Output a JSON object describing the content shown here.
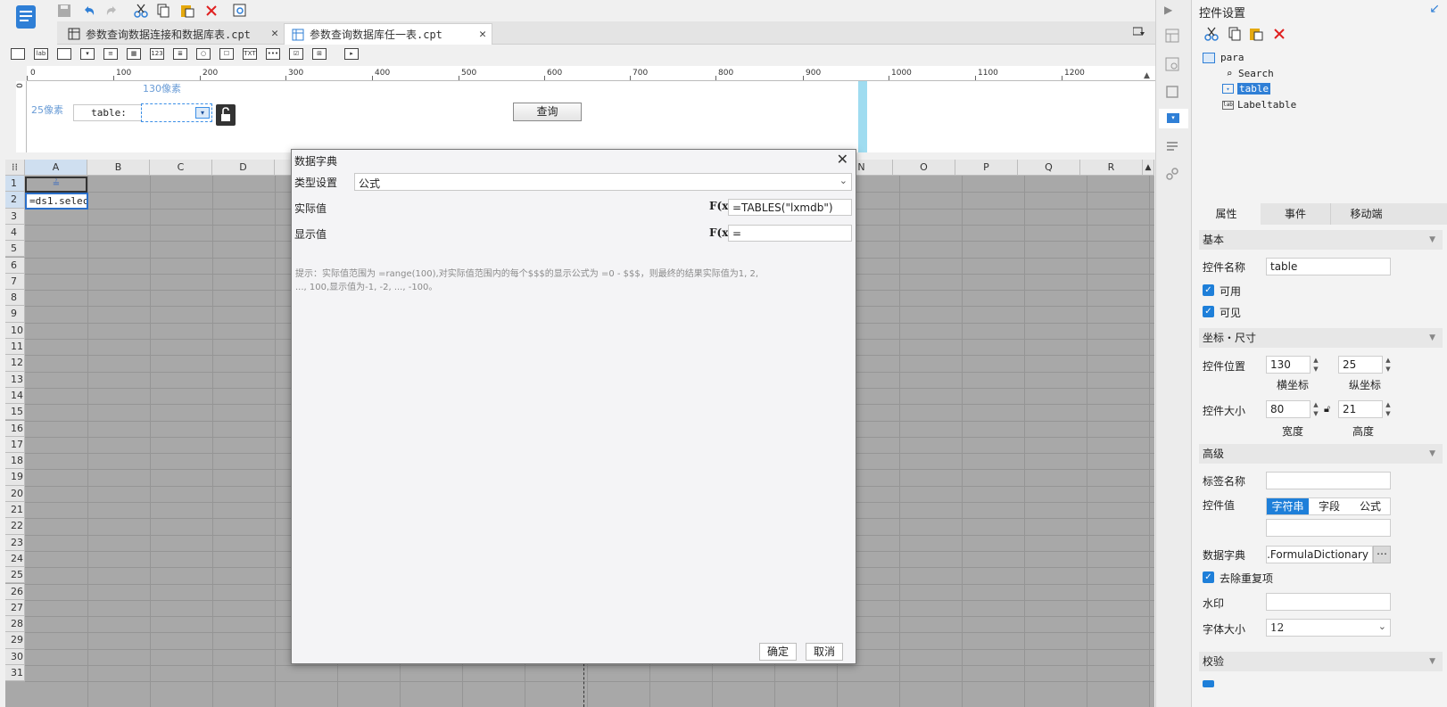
{
  "tabs": [
    {
      "label": "参数查询数据连接和数据库表.cpt"
    },
    {
      "label": "参数查询数据库任一表.cpt"
    }
  ],
  "ruler": {
    "ticks": [
      "0",
      "100",
      "200",
      "300",
      "400",
      "500",
      "600",
      "700",
      "800",
      "900",
      "1000",
      "1100",
      "1200"
    ],
    "vzero": "0"
  },
  "param": {
    "hint_x": "130像素",
    "hint_y": "25像素",
    "label": "table:",
    "query_button": "查询"
  },
  "sheet": {
    "columns": [
      "A",
      "B",
      "C",
      "D",
      "N",
      "O",
      "P",
      "Q",
      "R"
    ],
    "rows": [
      "1",
      "2",
      "3",
      "4",
      "5",
      "6",
      "7",
      "8",
      "9",
      "10",
      "11",
      "12",
      "13",
      "14",
      "15",
      "16",
      "17",
      "18",
      "19",
      "20",
      "21",
      "22",
      "23",
      "24",
      "25",
      "26",
      "27",
      "28",
      "29",
      "30",
      "31"
    ],
    "cell_a1": "≟",
    "cell_a2": "=ds1.selec"
  },
  "dialog": {
    "title": "数据字典",
    "type_label": "类型设置",
    "type_value": "公式",
    "actual_label": "实际值",
    "actual_value": "=TABLES(\"lxmdb\")",
    "display_label": "显示值",
    "display_value": "=",
    "fx": "F(x)",
    "hint_line1": "提示：实际值范围为 =range(100),对实际值范围内的每个$$$的显示公式为 =0 - $$$，则最终的结果实际值为1, 2,",
    "hint_line2": "..., 100,显示值为-1, -2, ..., -100。",
    "ok": "确定",
    "cancel": "取消"
  },
  "panel": {
    "title": "控件设置",
    "tree": {
      "root": "para",
      "items": [
        "Search",
        "table",
        "Labeltable"
      ]
    },
    "tabs": [
      "属性",
      "事件",
      "移动端"
    ],
    "sections": {
      "basic": "基本",
      "coords": "坐标・尺寸",
      "advanced": "高级",
      "validate": "校验"
    },
    "name_label": "控件名称",
    "name_value": "table",
    "enabled": "可用",
    "visible": "可见",
    "pos_label": "控件位置",
    "pos_x": "130",
    "pos_y": "25",
    "pos_x_cap": "横坐标",
    "pos_y_cap": "纵坐标",
    "size_label": "控件大小",
    "size_w": "80",
    "size_h": "21",
    "size_w_cap": "宽度",
    "size_h_cap": "高度",
    "tag_label": "标签名称",
    "tag_value": "",
    "value_label": "控件值",
    "value_tabs": [
      "字符串",
      "字段",
      "公式"
    ],
    "value_value": "",
    "dict_label": "数据字典",
    "dict_value": "npl.FormulaDictionary",
    "dedupe": "去除重复项",
    "watermark_label": "水印",
    "watermark_value": "",
    "fontsize_label": "字体大小",
    "fontsize_value": "12"
  },
  "colors": {
    "accent": "#1e7fd9",
    "sheet_bg": "#a8a8a8",
    "param_cyan": "#9fdcf0"
  }
}
